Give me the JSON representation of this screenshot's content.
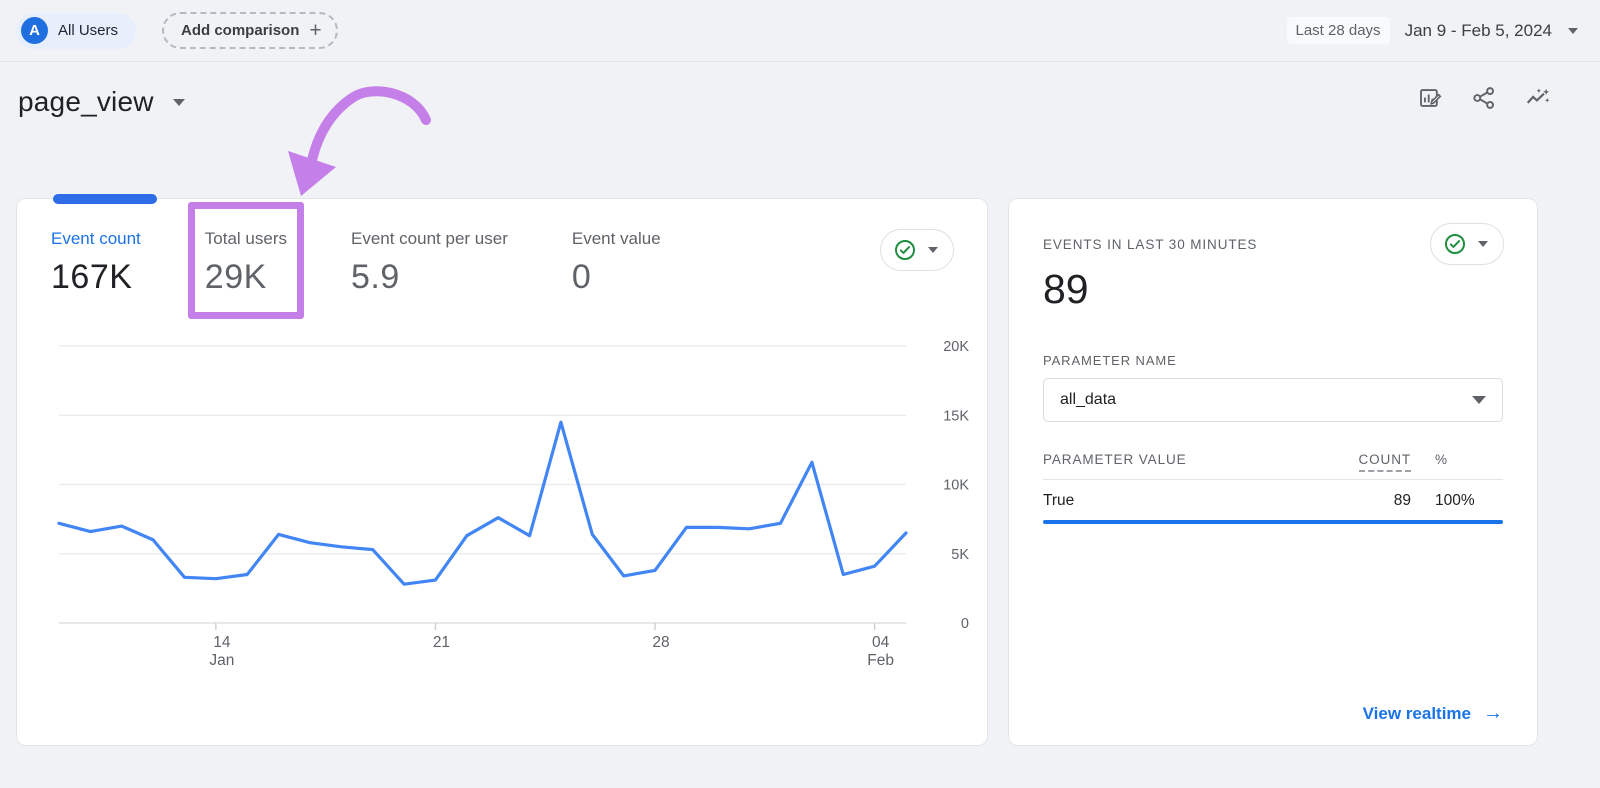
{
  "topbar": {
    "avatar_letter": "A",
    "all_users_label": "All Users",
    "add_comparison_label": "Add comparison",
    "plus_glyph": "+",
    "range_label": "Last 28 days",
    "date_range": "Jan 9 - Feb 5, 2024"
  },
  "header": {
    "title": "page_view",
    "icons": [
      "customize-report-icon",
      "share-icon",
      "insights-icon"
    ]
  },
  "metrics": {
    "tabs": [
      {
        "label": "Event count",
        "value": "167K",
        "active": true
      },
      {
        "label": "Total users",
        "value": "29K",
        "highlighted": true
      },
      {
        "label": "Event count per user",
        "value": "5.9"
      },
      {
        "label": "Event value",
        "value": "0"
      }
    ]
  },
  "chart_data": {
    "type": "line",
    "title": "",
    "xlabel": "",
    "ylabel": "",
    "grid": true,
    "legend": false,
    "line_color": "#4285f4",
    "ylim": [
      0,
      20000
    ],
    "x": [
      "Jan 9",
      "Jan 10",
      "Jan 11",
      "Jan 12",
      "Jan 13",
      "Jan 14",
      "Jan 15",
      "Jan 16",
      "Jan 17",
      "Jan 18",
      "Jan 19",
      "Jan 20",
      "Jan 21",
      "Jan 22",
      "Jan 23",
      "Jan 24",
      "Jan 25",
      "Jan 26",
      "Jan 27",
      "Jan 28",
      "Jan 29",
      "Jan 30",
      "Jan 31",
      "Feb 1",
      "Feb 2",
      "Feb 3",
      "Feb 4",
      "Feb 5"
    ],
    "series": [
      {
        "name": "Event count",
        "values": [
          7200,
          6600,
          7000,
          6000,
          3300,
          3200,
          3500,
          6400,
          5800,
          5500,
          5300,
          2800,
          3100,
          6300,
          7600,
          6300,
          14500,
          6400,
          3400,
          3800,
          6900,
          6900,
          6800,
          7200,
          11600,
          3500,
          4100,
          6500
        ]
      }
    ],
    "y_ticks": [
      {
        "value": 0,
        "label": "0"
      },
      {
        "value": 5000,
        "label": "5K"
      },
      {
        "value": 10000,
        "label": "10K"
      },
      {
        "value": 15000,
        "label": "15K"
      },
      {
        "value": 20000,
        "label": "20K"
      }
    ],
    "x_ticks": [
      {
        "index": 5,
        "lines": [
          "14",
          "Jan"
        ]
      },
      {
        "index": 12,
        "lines": [
          "21"
        ]
      },
      {
        "index": 19,
        "lines": [
          "28"
        ]
      },
      {
        "index": 26,
        "lines": [
          "04",
          "Feb"
        ]
      }
    ]
  },
  "realtime": {
    "title": "EVENTS IN LAST 30 MINUTES",
    "value": "89",
    "parameter_name_label": "PARAMETER NAME",
    "parameter_name_value": "all_data",
    "table": {
      "headers": {
        "value": "PARAMETER VALUE",
        "count": "COUNT",
        "percent": "%"
      },
      "rows": [
        {
          "value": "True",
          "count": "89",
          "percent": "100%",
          "bar_pct": 100
        }
      ]
    },
    "link_label": "View realtime",
    "arrow_glyph": "→"
  },
  "colors": {
    "accent_blue": "#1a73e8",
    "chart_line_blue": "#4285f4",
    "check_green": "#1e8e3e",
    "annotation_purple": "#c57fe8"
  }
}
